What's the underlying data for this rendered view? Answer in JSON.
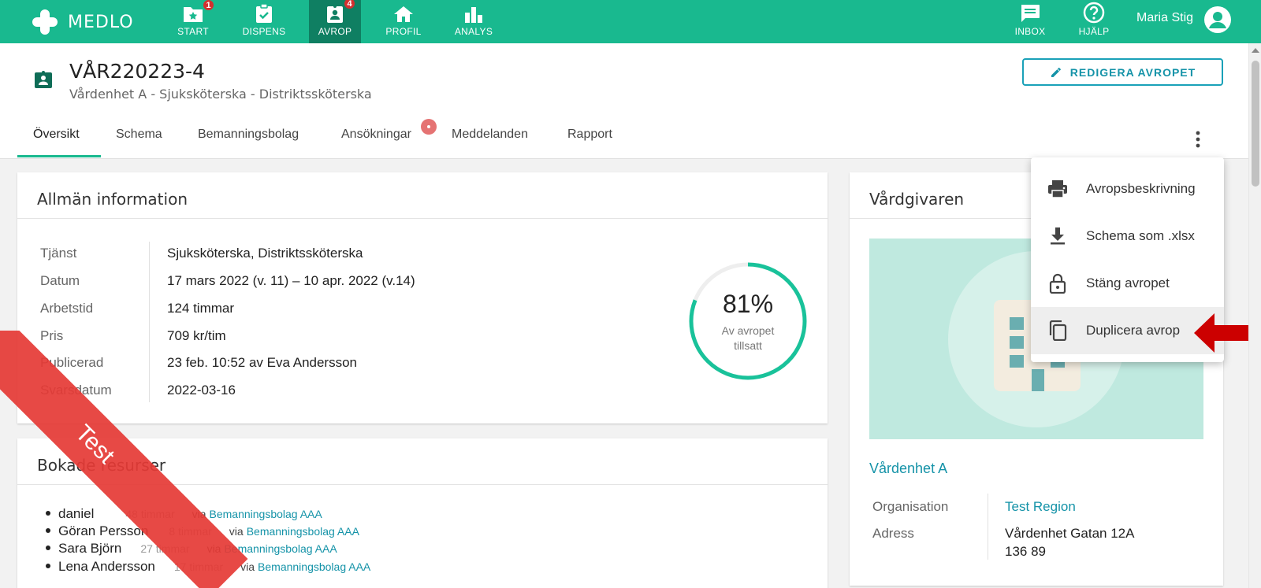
{
  "app": {
    "logo_text": "MEDLO",
    "user_name": "Maria Stig"
  },
  "nav": {
    "items": [
      {
        "label": "START",
        "badge": "1"
      },
      {
        "label": "DISPENS",
        "badge": ""
      },
      {
        "label": "AVROP",
        "badge": "4"
      },
      {
        "label": "PROFIL",
        "badge": ""
      },
      {
        "label": "ANALYS",
        "badge": ""
      }
    ],
    "inbox_label": "INBOX",
    "help_label": "HJÄLP"
  },
  "header": {
    "title": "VÅR220223-4",
    "subtitle": "Vårdenhet A - Sjuksköterska - Distriktssköterska",
    "edit_button": "REDIGERA AVROPET"
  },
  "tabs": [
    "Översikt",
    "Schema",
    "Bemanningsbolag",
    "Ansökningar",
    "Meddelanden",
    "Rapport"
  ],
  "general": {
    "title": "Allmän information",
    "rows": [
      {
        "label": "Tjänst",
        "value": "Sjuksköterska, Distriktssköterska"
      },
      {
        "label": "Datum",
        "value": "17 mars 2022 (v. 11) – 10 apr. 2022 (v.14)"
      },
      {
        "label": "Arbetstid",
        "value": "124 timmar"
      },
      {
        "label": "Pris",
        "value": "709 kr/tim"
      },
      {
        "label": "Publicerad",
        "value": "23 feb. 10:52 av Eva Andersson"
      },
      {
        "label": "Svarsdatum",
        "value": "2022-03-16"
      }
    ],
    "progress_text": "81%",
    "progress_value": 0.81,
    "progress_caption_1": "Av avropet",
    "progress_caption_2": "tillsatt"
  },
  "resources": {
    "title": "Bokade resurser",
    "via": "via",
    "items": [
      {
        "name": "daniel",
        "hours": "48 timmar",
        "company": "Bemanningsbolag AAA"
      },
      {
        "name": "Göran Persson",
        "hours": "8 timmar",
        "company": "Bemanningsbolag AAA"
      },
      {
        "name": "Sara Björn",
        "hours": "27 timmar",
        "company": "Bemanningsbolag AAA"
      },
      {
        "name": "Lena Andersson",
        "hours": "17 timmar",
        "company": "Bemanningsbolag AAA"
      }
    ]
  },
  "provider": {
    "title": "Vårdgivaren",
    "unit_name": "Vårdenhet A",
    "org_label": "Organisation",
    "org_value": "Test Region",
    "address_label": "Adress",
    "address_line1": "Vårdenhet Gatan 12A",
    "address_line2": "136 89"
  },
  "menu": {
    "items": [
      {
        "label": "Avropsbeskrivning",
        "icon": "print-icon"
      },
      {
        "label": "Schema som .xlsx",
        "icon": "download-icon"
      },
      {
        "label": "Stäng avropet",
        "icon": "lock-icon"
      },
      {
        "label": "Duplicera avrop",
        "icon": "copy-icon"
      }
    ]
  },
  "ribbon": {
    "text": "Test"
  },
  "colors": {
    "brand": "#19b98f",
    "brand_dark": "#0f7f62",
    "link": "#1593a8",
    "ribbon": "#e53935",
    "arrow": "#cc0000"
  }
}
